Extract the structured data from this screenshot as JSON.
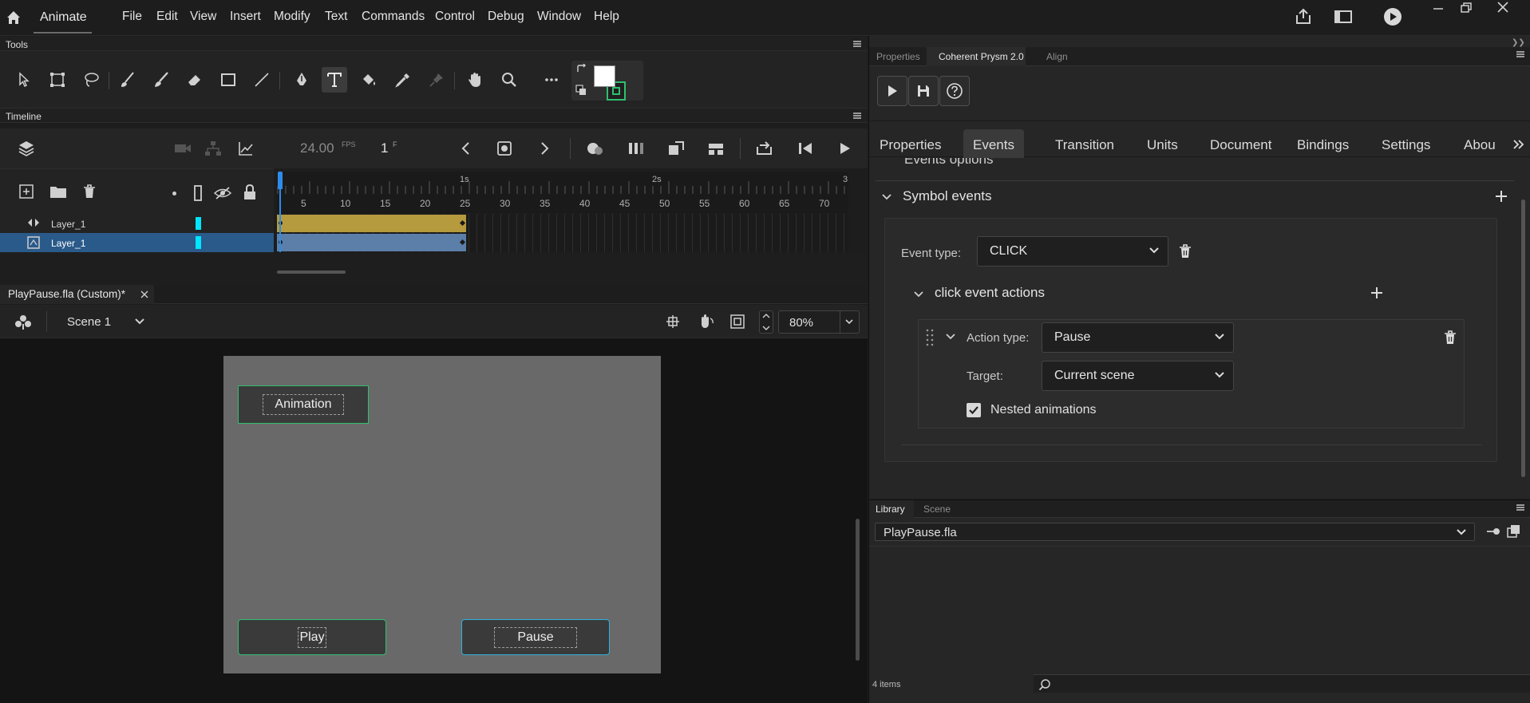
{
  "app": {
    "name": "Animate"
  },
  "menu": [
    "File",
    "Edit",
    "View",
    "Insert",
    "Modify",
    "Text",
    "Commands",
    "Control",
    "Debug",
    "Window",
    "Help"
  ],
  "tools_panel": {
    "title": "Tools"
  },
  "timeline": {
    "title": "Timeline",
    "fps": "24.00",
    "fps_unit": "FPS",
    "frame": "1",
    "frame_unit": "F",
    "ruler_numbers": [
      "5",
      "10",
      "15",
      "20",
      "25",
      "30",
      "35",
      "40",
      "45",
      "50",
      "55",
      "60",
      "65",
      "70"
    ],
    "ruler_seconds": [
      "1s",
      "2s",
      "3"
    ],
    "layers": [
      {
        "name": "Layer_1",
        "color": "#00e5ff",
        "selected": false
      },
      {
        "name": "Layer_1",
        "color": "#00e5ff",
        "selected": true
      }
    ]
  },
  "document": {
    "tab_title": "PlayPause.fla (Custom)*",
    "scene": "Scene 1",
    "zoom": "80%"
  },
  "stage": {
    "buttons": [
      {
        "label": "Animation"
      },
      {
        "label": "Play"
      },
      {
        "label": "Pause"
      }
    ]
  },
  "right_panel": {
    "tabs": [
      "Properties",
      "Coherent Prysm 2.0",
      "Align"
    ],
    "active_tab": "Coherent Prysm 2.0",
    "sub_tabs": [
      "Properties",
      "Events",
      "Transition",
      "Units",
      "Document",
      "Bindings",
      "Settings",
      "Abou"
    ],
    "active_sub_tab": "Events",
    "events_options_label": "Events options",
    "symbol_events_label": "Symbol events",
    "event_type_label": "Event type:",
    "event_type_value": "CLICK",
    "click_actions_label": "click event actions",
    "action_type_label": "Action type:",
    "action_type_value": "Pause",
    "target_label": "Target:",
    "target_value": "Current scene",
    "nested_label": "Nested animations",
    "nested_checked": true
  },
  "library": {
    "tabs": [
      "Library",
      "Scene"
    ],
    "active_tab": "Library",
    "file": "PlayPause.fla",
    "items_count": "4 items"
  },
  "colors": {
    "accent": "#2d8ceb",
    "keyframe_bar": "#b59a3e",
    "selected_bar": "#5b7fa8",
    "stage": "#696969",
    "green_outline": "#2fbf6f"
  }
}
